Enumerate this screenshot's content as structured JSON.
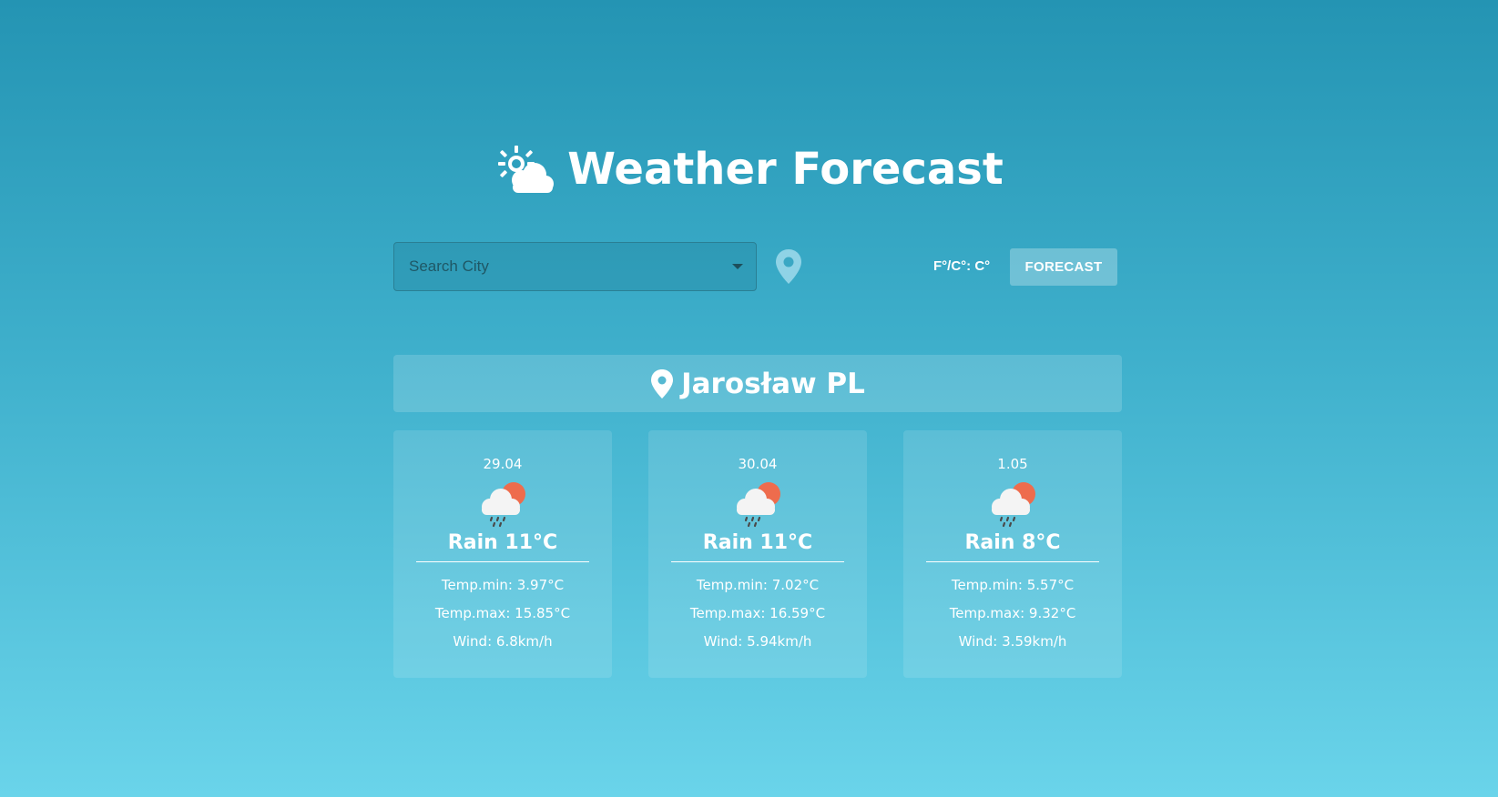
{
  "app": {
    "title": "Weather Forecast",
    "title_icon": "sun-cloud-icon"
  },
  "search": {
    "placeholder": "Search City",
    "value": ""
  },
  "controls": {
    "location_icon": "map-pin-icon",
    "unit_toggle_label": "F°/C°: C°",
    "forecast_button_label": "FORECAST"
  },
  "location": {
    "icon": "map-pin-icon",
    "city": "Jarosław PL"
  },
  "forecast": [
    {
      "date": "29.04",
      "icon": "rain-sun-cloud-icon",
      "summary": "Rain 11°C",
      "temp_min": "Temp.min: 3.97°C",
      "temp_max": "Temp.max: 15.85°C",
      "wind": "Wind: 6.8km/h"
    },
    {
      "date": "30.04",
      "icon": "rain-sun-cloud-icon",
      "summary": "Rain 11°C",
      "temp_min": "Temp.min: 7.02°C",
      "temp_max": "Temp.max: 16.59°C",
      "wind": "Wind: 5.94km/h"
    },
    {
      "date": "1.05",
      "icon": "rain-sun-cloud-icon",
      "summary": "Rain 8°C",
      "temp_min": "Temp.min: 5.57°C",
      "temp_max": "Temp.max: 9.32°C",
      "wind": "Wind: 3.59km/h"
    }
  ],
  "colors": {
    "background_top": "#2494b3",
    "background_bottom": "#6ad4ea",
    "sun": "#ee6c4d",
    "cloud": "#ffffff",
    "rain": "#4a4a4a",
    "location_pin_control": "#8fd3e6"
  }
}
